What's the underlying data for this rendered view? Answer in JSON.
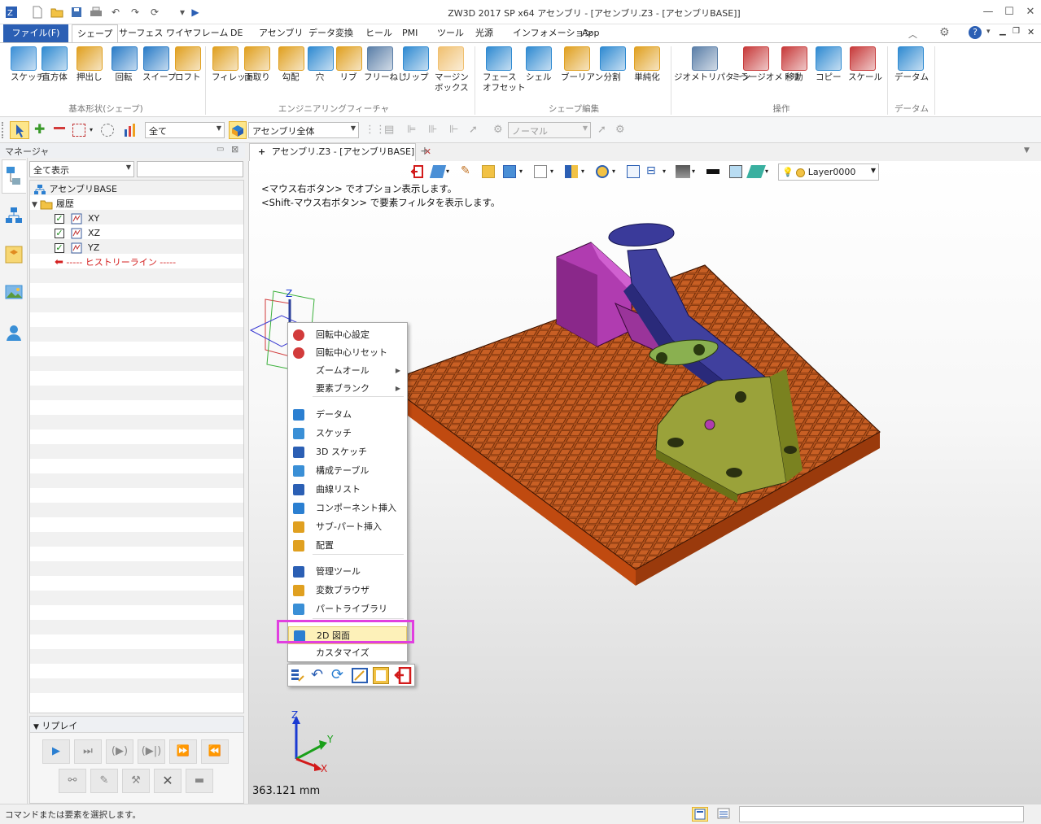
{
  "window": {
    "title": "ZW3D 2017 SP x64        アセンブリ - [アセンブリ.Z3 - [アセンブリBASE]]"
  },
  "tabs": [
    {
      "label": "ファイル(F)"
    },
    {
      "label": "シェープ"
    },
    {
      "label": "サーフェス"
    },
    {
      "label": "ワイヤフレーム"
    },
    {
      "label": "DE"
    },
    {
      "label": "アセンブリ"
    },
    {
      "label": "データ変換"
    },
    {
      "label": "ヒール"
    },
    {
      "label": "PMI"
    },
    {
      "label": "ツール"
    },
    {
      "label": "光源"
    },
    {
      "label": "インフォメーション"
    },
    {
      "label": "App"
    }
  ],
  "ribbon": {
    "buttons": [
      {
        "label": "スケッチ",
        "icon": "sketch-icon",
        "color": "#3a8fd6"
      },
      {
        "label": "直方体",
        "icon": "box-icon",
        "color": "#2f8ad1"
      },
      {
        "label": "押出し",
        "icon": "extrude-icon",
        "color": "#e0a020"
      },
      {
        "label": "回転",
        "icon": "revolve-icon",
        "color": "#2a7cc7"
      },
      {
        "label": "スイープ",
        "icon": "sweep-icon",
        "color": "#2a7cc7"
      },
      {
        "label": "ロフト",
        "icon": "loft-icon",
        "color": "#e0a020"
      },
      {
        "label": "フィレット",
        "icon": "fillet-icon",
        "color": "#e0a020"
      },
      {
        "label": "面取り",
        "icon": "chamfer-icon",
        "color": "#e0a020"
      },
      {
        "label": "勾配",
        "icon": "draft-icon",
        "color": "#e0a020"
      },
      {
        "label": "穴",
        "icon": "hole-icon",
        "color": "#2f8ad1"
      },
      {
        "label": "リブ",
        "icon": "rib-icon",
        "color": "#e0a020"
      },
      {
        "label": "フリーねじ",
        "icon": "thread-icon",
        "color": "#5b7fa8"
      },
      {
        "label": "リップ",
        "icon": "lip-icon",
        "color": "#2f8ad1"
      },
      {
        "label": "マージン\nボックス",
        "icon": "margin-box-icon",
        "color": "#f0c070"
      },
      {
        "label": "フェース\nオフセット",
        "icon": "face-offset-icon",
        "color": "#2f8ad1"
      },
      {
        "label": "シェル",
        "icon": "shell-icon",
        "color": "#2f8ad1"
      },
      {
        "label": "ブーリアン",
        "icon": "boolean-icon",
        "color": "#e0a020"
      },
      {
        "label": "分割",
        "icon": "split-icon",
        "color": "#2f8ad1"
      },
      {
        "label": "単純化",
        "icon": "simplify-icon",
        "color": "#e0a020"
      },
      {
        "label": "ジオメトリパターン",
        "icon": "pattern-icon",
        "color": "#5b7fa8"
      },
      {
        "label": "ミラージオメトリ",
        "icon": "mirror-icon",
        "color": "#c73a3a"
      },
      {
        "label": "移動",
        "icon": "move-icon",
        "color": "#c73a3a"
      },
      {
        "label": "コピー",
        "icon": "copy-icon",
        "color": "#2f8ad1"
      },
      {
        "label": "スケール",
        "icon": "scale-icon",
        "color": "#c73a3a"
      },
      {
        "label": "データム",
        "icon": "datum-icon",
        "color": "#2f8ad1"
      }
    ],
    "groups": [
      "基本形状(シェープ)",
      "エンジニアリングフィーチャ",
      "シェープ編集",
      "操作",
      "データム"
    ]
  },
  "toolbar": {
    "filter_value": "全て",
    "scope_value": "アセンブリ全体",
    "mode_value": "ノーマル"
  },
  "manager": {
    "title": "マネージャ",
    "filter_value": "全て表示",
    "tree": [
      {
        "label": "アセンブリBASE",
        "level": 0
      },
      {
        "label": "履歴",
        "level": 1
      },
      {
        "label": "XY",
        "level": 2
      },
      {
        "label": "XZ",
        "level": 2
      },
      {
        "label": "YZ",
        "level": 2
      },
      {
        "label": "----- ヒストリーライン -----",
        "level": 2
      }
    ]
  },
  "replay": {
    "title": "リプレイ"
  },
  "document_tab": {
    "label": "アセンブリ.Z3 - [アセンブリBASE]"
  },
  "viewport": {
    "hint1": "<マウス右ボタン> でオプション表示します。",
    "hint2": "<Shift-マウス右ボタン> で要素フィルタを表示します。",
    "layer": "Layer0000",
    "measure": "363.121 mm",
    "axis_x": "X",
    "axis_y": "Y",
    "axis_z": "Z"
  },
  "context_menu": {
    "items": [
      {
        "label": "回転中心設定",
        "icon": "rotate-center-icon"
      },
      {
        "label": "回転中心リセット",
        "icon": "rotate-reset-icon"
      },
      {
        "label": "ズームオール",
        "icon": "",
        "submenu": true
      },
      {
        "label": "要素ブランク",
        "icon": "",
        "submenu": true
      },
      {
        "label": "データム",
        "icon": "datum-icon"
      },
      {
        "label": "スケッチ",
        "icon": "sketch-icon"
      },
      {
        "label": "3D スケッチ",
        "icon": "3d-sketch-icon"
      },
      {
        "label": "構成テーブル",
        "icon": "config-table-icon"
      },
      {
        "label": "曲線リスト",
        "icon": "curve-list-icon"
      },
      {
        "label": "コンポーネント挿入",
        "icon": "insert-component-icon"
      },
      {
        "label": "サブ-パート挿入",
        "icon": "insert-subpart-icon"
      },
      {
        "label": "配置",
        "icon": "place-icon"
      },
      {
        "label": "管理ツール",
        "icon": "manager-tool-icon"
      },
      {
        "label": "変数ブラウザ",
        "icon": "variable-browser-icon"
      },
      {
        "label": "パートライブラリ",
        "icon": "part-library-icon"
      },
      {
        "label": "2D 図面",
        "icon": "2d-drawing-icon"
      },
      {
        "label": "カスタマイズ",
        "icon": ""
      }
    ]
  },
  "status": {
    "text": "コマンドまたは要素を選択します。"
  },
  "colors": {
    "accent": "#2b5fb4",
    "highlight": "#e13fe0",
    "menu_selected": "#fdf1b9",
    "base_plate": "#b5531c"
  }
}
